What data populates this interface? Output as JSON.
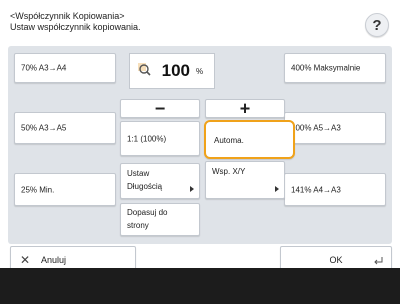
{
  "header": {
    "title_line1": "<Współczynnik Kopiowania>",
    "title_line2": "Ustaw współczynnik kopiowania.",
    "help_label": "?"
  },
  "presets_left": [
    "70% A3→A4",
    "50% A3→A5",
    "25% Min."
  ],
  "presets_right": [
    "400% Maksymalnie",
    "200% A5→A3",
    "141% A4→A3"
  ],
  "zoom": {
    "value": "100",
    "unit": "%",
    "icon": "zoom-magnifier-icon"
  },
  "controls": {
    "minus": "−",
    "plus": "+",
    "one_to_one": "1:1 (100%)",
    "auto": "Automa.",
    "set_length_l1": "Ustaw",
    "set_length_l2": "Długością",
    "xy": "Wsp. X/Y",
    "fit_l1": "Dopasuj do",
    "fit_l2": "strony"
  },
  "bottom": {
    "cancel_label": "Anuluj",
    "ok_label": "OK"
  },
  "colors": {
    "selected_outline": "#f0a21a",
    "panel_bg": "#dfe3e8",
    "footer_bg": "#1c1c1c"
  }
}
